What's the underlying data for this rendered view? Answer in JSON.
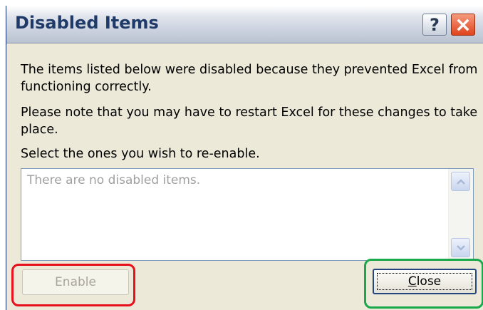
{
  "dialog": {
    "title": "Disabled Items",
    "help_glyph": "?",
    "message_line1": "The items listed below were disabled because they prevented Excel from functioning correctly.",
    "message_line2": "Please note that you may have to restart Excel for these changes to take place.",
    "message_line3": "Select the ones you wish to re-enable.",
    "list_placeholder": "There are no disabled items.",
    "enable_label": "Enable",
    "close_label_mnemonic": "C",
    "close_label_rest": "lose"
  },
  "annotations": {
    "red_box_color": "#e8101c",
    "green_box_color": "#19a84c"
  },
  "icons": {
    "help": "question-mark-icon",
    "close": "x-icon",
    "scroll_up": "chevron-up-icon",
    "scroll_down": "chevron-down-icon"
  }
}
